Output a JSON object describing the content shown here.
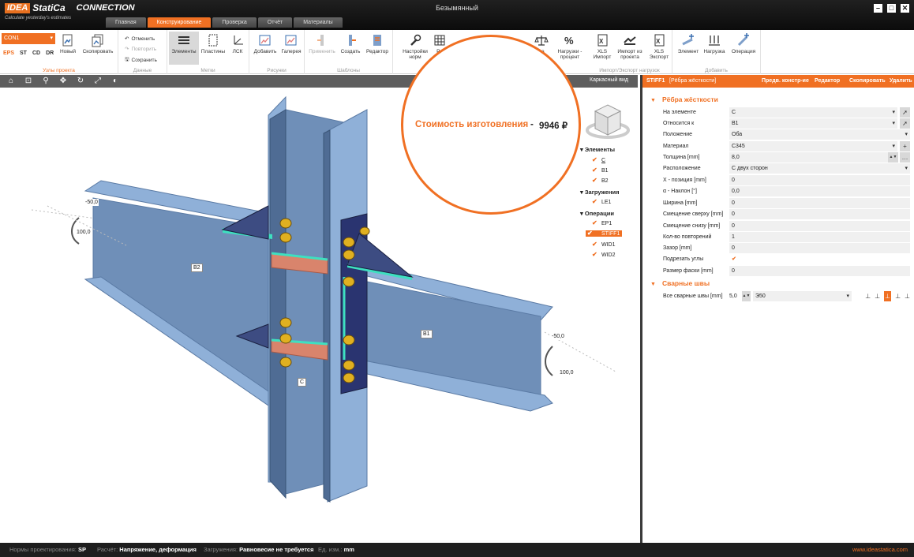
{
  "app": {
    "logo_idea": "IDEA",
    "logo_statica": "StatiCa",
    "logo_product": "CONNECTION",
    "tagline": "Calculate yesterday's estimates",
    "window_title": "Безымянный"
  },
  "tabs": [
    "Главная",
    "Конструирование",
    "Проверка",
    "Отчёт",
    "Материалы"
  ],
  "ribbon": {
    "connection_select": "CON1",
    "norm_codes": [
      "EPS",
      "ST",
      "CD",
      "DR"
    ],
    "new_label": "Новый",
    "copy_label": "Скопировать",
    "group_project": "Узлы проекта",
    "undo": "Отменить",
    "redo": "Повторить",
    "save": "Сохранить",
    "group_data": "Данные",
    "elements": "Элементы",
    "plates": "Пластины",
    "lcs": "ЛСК",
    "group_labels": "Метки",
    "add": "Добавить",
    "gallery": "Галерея",
    "group_pictures": "Рисунки",
    "apply": "Применить",
    "create": "Создать",
    "editor": "Редактор",
    "group_templates": "Шаблоны",
    "norm_settings": "Настройки норм",
    "calc_partial": "Ра",
    "balance_partial": "ие",
    "loads_percent": "Нагрузки - процент",
    "xls_import": "XLS Импорт",
    "import_from_project": "Импорт из проекта",
    "xls_export": "XLS Экспорт",
    "group_import_export": "Импорт/Экспорт нагрузок",
    "add_element": "Элемент",
    "add_load": "Нагрузка",
    "add_operation": "Операция",
    "group_add": "Добавить"
  },
  "viewport": {
    "view_label_left": "id",
    "view_label": "Каркасный вид",
    "member_labels": {
      "b2": "B2",
      "b1": "B1",
      "c": "C"
    },
    "dims": {
      "left_top": "-50,0",
      "left_mid": "100,0",
      "right_top": "-50,0",
      "right_mid": "100,0"
    }
  },
  "callout": {
    "label": "Стоимость изготовления",
    "dash": "-",
    "value": "9946 ₽"
  },
  "tree": {
    "elements_header": "Элементы",
    "elements": [
      "C",
      "B1",
      "B2"
    ],
    "loads_header": "Загружения",
    "loads": [
      "LE1"
    ],
    "operations_header": "Операции",
    "operations": [
      "EP1",
      "STIFF1",
      "WID1",
      "WID2"
    ]
  },
  "panel": {
    "title": "STIFF1",
    "subtitle": "[Рёбра жёсткости]",
    "actions": [
      "Предв. констр-ие",
      "Редактор",
      "Скопировать",
      "Удалить"
    ],
    "section_stiffeners": "Рёбра жёсткости",
    "rows": [
      {
        "label": "На элементе",
        "value": "C"
      },
      {
        "label": "Относится к",
        "value": "B1"
      },
      {
        "label": "Положение",
        "value": "Оба"
      },
      {
        "label": "Материал",
        "value": "C345"
      },
      {
        "label": "Толщина [mm]",
        "value": "8,0"
      },
      {
        "label": "Расположение",
        "value": "С двух сторон"
      },
      {
        "label": "X - позиция [mm]",
        "value": "0"
      },
      {
        "label": "α - Наклон [°]",
        "value": "0,0"
      },
      {
        "label": "Ширина [mm]",
        "value": "0"
      },
      {
        "label": "Смещение сверху [mm]",
        "value": "0"
      },
      {
        "label": "Смещение снизу [mm]",
        "value": "0"
      },
      {
        "label": "Кол-во повторений",
        "value": "1"
      },
      {
        "label": "Зазор [mm]",
        "value": "0"
      },
      {
        "label": "Подрезать углы",
        "value": "✔"
      },
      {
        "label": "Размер фаски [mm]",
        "value": "0"
      }
    ],
    "section_welds": "Сварные швы",
    "weld_label": "Все сварные швы [mm]",
    "weld_size": "5,0",
    "weld_material": "Э50"
  },
  "status": {
    "norms_label": "Нормы проектирования:",
    "norms_value": "SP",
    "calc_label": "Расчёт:",
    "calc_value": "Напряжение, деформация",
    "loads_label": "Загружения:",
    "loads_value": "Равновесие не требуется",
    "units_label": "Ед. изм.:",
    "units_value": "mm",
    "site": "www.ideastatica.com"
  },
  "colors": {
    "accent": "#f07023",
    "steel": "#7e9fca",
    "weld": "#3ee0c0",
    "stiffener": "#d9846c"
  }
}
